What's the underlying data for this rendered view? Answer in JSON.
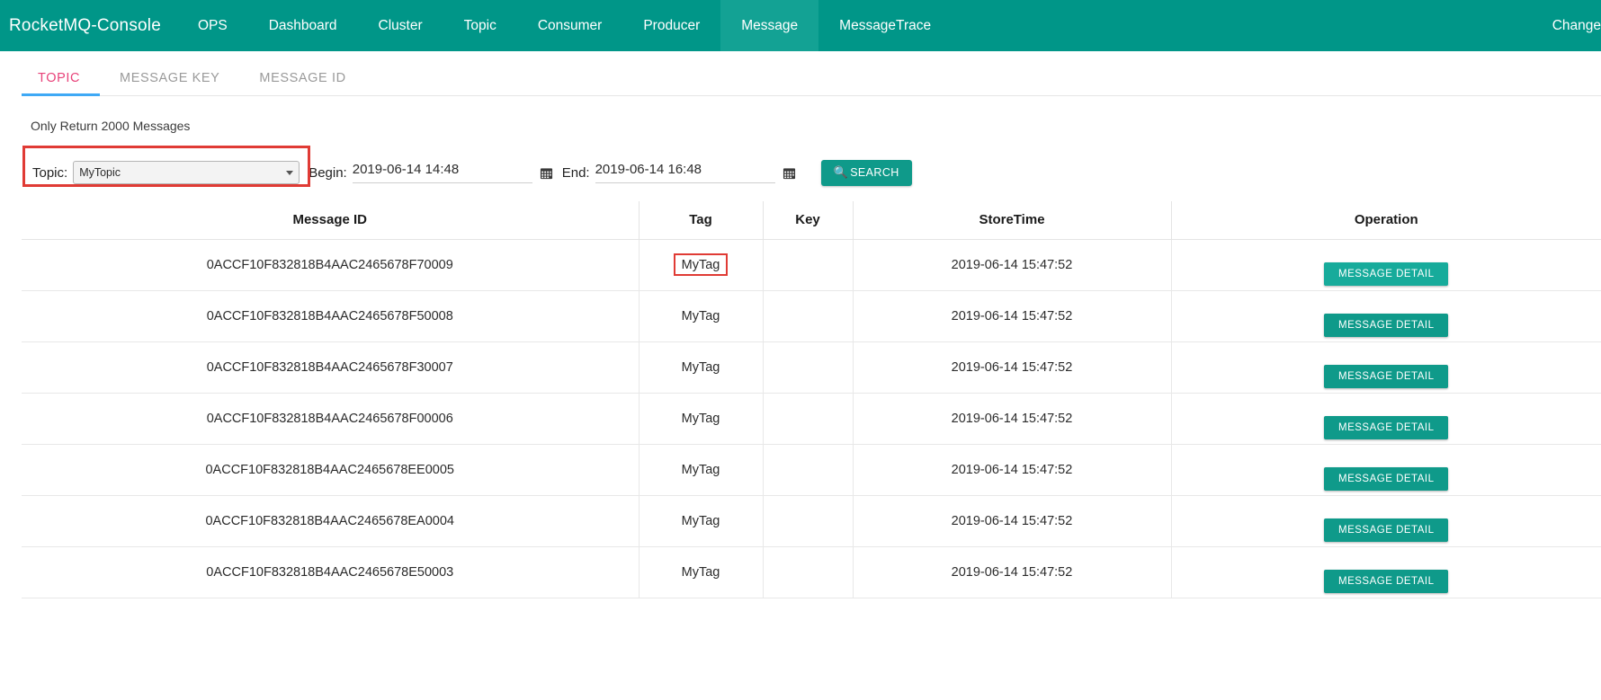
{
  "navbar": {
    "brand": "RocketMQ-Console",
    "items": [
      {
        "label": "OPS",
        "active": false
      },
      {
        "label": "Dashboard",
        "active": false
      },
      {
        "label": "Cluster",
        "active": false
      },
      {
        "label": "Topic",
        "active": false
      },
      {
        "label": "Consumer",
        "active": false
      },
      {
        "label": "Producer",
        "active": false
      },
      {
        "label": "Message",
        "active": true
      },
      {
        "label": "MessageTrace",
        "active": false
      }
    ],
    "right_item": "Change"
  },
  "tabs": [
    {
      "label": "TOPIC",
      "active": true
    },
    {
      "label": "MESSAGE KEY",
      "active": false
    },
    {
      "label": "MESSAGE ID",
      "active": false
    }
  ],
  "hint": "Only Return 2000 Messages",
  "search": {
    "topic_label": "Topic:",
    "topic_value": "MyTopic",
    "begin_label": "Begin:",
    "begin_value": "2019-06-14 14:48",
    "end_label": "End:",
    "end_value": "2019-06-14 16:48",
    "search_button": "SEARCH",
    "search_icon": "magnifier-icon",
    "calendar_icon": "calendar-icon"
  },
  "table": {
    "headers": [
      "Message ID",
      "Tag",
      "Key",
      "StoreTime",
      "Operation"
    ],
    "action_label": "MESSAGE DETAIL",
    "rows": [
      {
        "id": "0ACCF10F832818B4AAC2465678F70009",
        "tag": "MyTag",
        "key": "",
        "time": "2019-06-14 15:47:52",
        "tag_boxed": true,
        "btn_hovered": true
      },
      {
        "id": "0ACCF10F832818B4AAC2465678F50008",
        "tag": "MyTag",
        "key": "",
        "time": "2019-06-14 15:47:52",
        "tag_boxed": false,
        "btn_hovered": false
      },
      {
        "id": "0ACCF10F832818B4AAC2465678F30007",
        "tag": "MyTag",
        "key": "",
        "time": "2019-06-14 15:47:52",
        "tag_boxed": false,
        "btn_hovered": false
      },
      {
        "id": "0ACCF10F832818B4AAC2465678F00006",
        "tag": "MyTag",
        "key": "",
        "time": "2019-06-14 15:47:52",
        "tag_boxed": false,
        "btn_hovered": false
      },
      {
        "id": "0ACCF10F832818B4AAC2465678EE0005",
        "tag": "MyTag",
        "key": "",
        "time": "2019-06-14 15:47:52",
        "tag_boxed": false,
        "btn_hovered": false
      },
      {
        "id": "0ACCF10F832818B4AAC2465678EA0004",
        "tag": "MyTag",
        "key": "",
        "time": "2019-06-14 15:47:52",
        "tag_boxed": false,
        "btn_hovered": false
      },
      {
        "id": "0ACCF10F832818B4AAC2465678E50003",
        "tag": "MyTag",
        "key": "",
        "time": "2019-06-14 15:47:52",
        "tag_boxed": false,
        "btn_hovered": false
      }
    ]
  },
  "colors": {
    "brand_teal": "#009688",
    "active_nav": "#13a294",
    "button_teal": "#0f9a8a",
    "tab_active": "#e8437a",
    "tab_underline": "#3fa9f5",
    "annotation_red": "#e03b35"
  }
}
